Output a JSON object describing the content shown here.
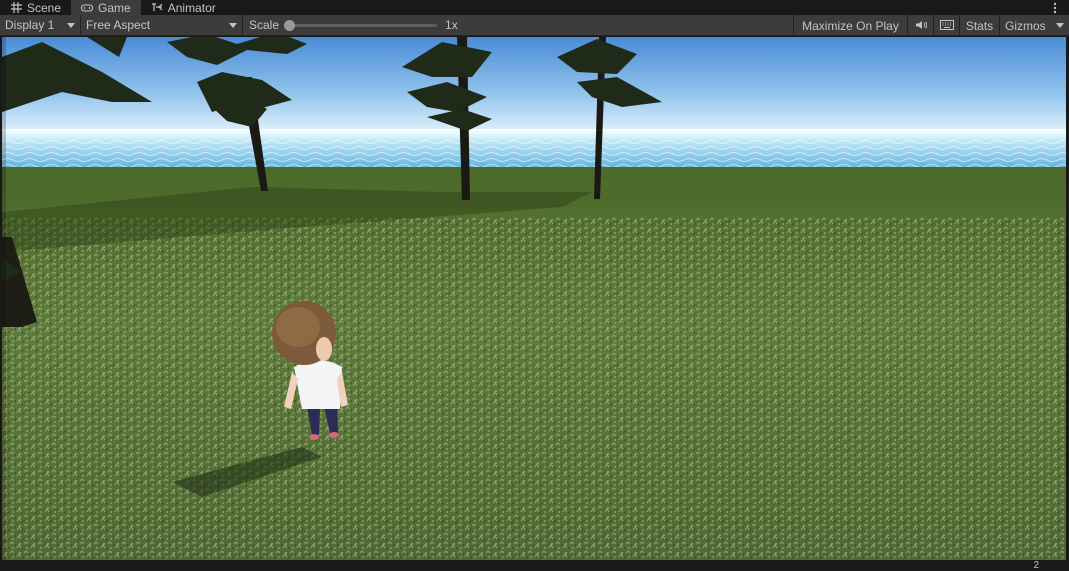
{
  "tabs": [
    {
      "label": "Scene",
      "icon": "grid-icon"
    },
    {
      "label": "Game",
      "icon": "gamepad-icon"
    },
    {
      "label": "Animator",
      "icon": "animator-icon"
    }
  ],
  "toolbar": {
    "display_label": "Display 1",
    "aspect_label": "Free Aspect",
    "scale_label": "Scale",
    "scale_value": "1x",
    "scale_fraction": 0.0,
    "maximize_label": "Maximize On Play",
    "stats_label": "Stats",
    "gizmos_label": "Gizmos"
  },
  "status": {
    "count": "2"
  },
  "colors": {
    "sky_top": "#4f8fd8",
    "sky_horizon": "#dceefa",
    "water": "#8fd0ea",
    "grass": "#5a7a35",
    "editor_bg": "#3c3c3c"
  }
}
